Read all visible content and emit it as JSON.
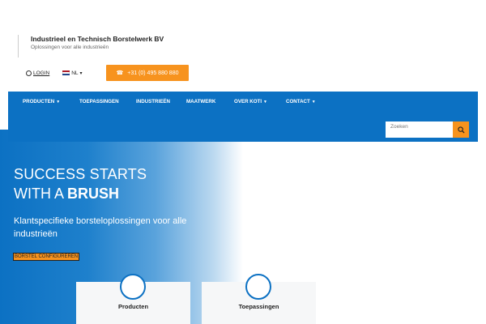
{
  "brand": {
    "title": "Industrieel en Technisch Borstelwerk BV",
    "subtitle": "Oplossingen voor alle industrieën"
  },
  "topbar": {
    "login_label": "LOGIN",
    "language_label": "NL",
    "phone_label": "+31 (0) 495 880 880"
  },
  "nav": {
    "items": [
      {
        "label": "PRODUCTEN",
        "has_dropdown": true
      },
      {
        "label": "TOEPASSINGEN",
        "has_dropdown": false
      },
      {
        "label": "INDUSTRIEËN",
        "has_dropdown": false
      },
      {
        "label": "MAATWERK",
        "has_dropdown": false
      },
      {
        "label": "OVER KOTI",
        "has_dropdown": true
      },
      {
        "label": "CONTACT",
        "has_dropdown": true
      }
    ]
  },
  "search": {
    "placeholder": "Zoeken"
  },
  "hero": {
    "line1": "SUCCESS STARTS",
    "line2_prefix": "WITH A ",
    "line2_bold": "BRUSH",
    "subtitle": "Klantspecifieke borsteloplossingen voor alle industrieën",
    "cta_label": "BORSTEL CONFIGUREREN"
  },
  "cards": [
    {
      "label": "Producten"
    },
    {
      "label": "Toepassingen"
    }
  ],
  "colors": {
    "primary_blue": "#0c71c3",
    "accent_orange": "#f7931e"
  }
}
